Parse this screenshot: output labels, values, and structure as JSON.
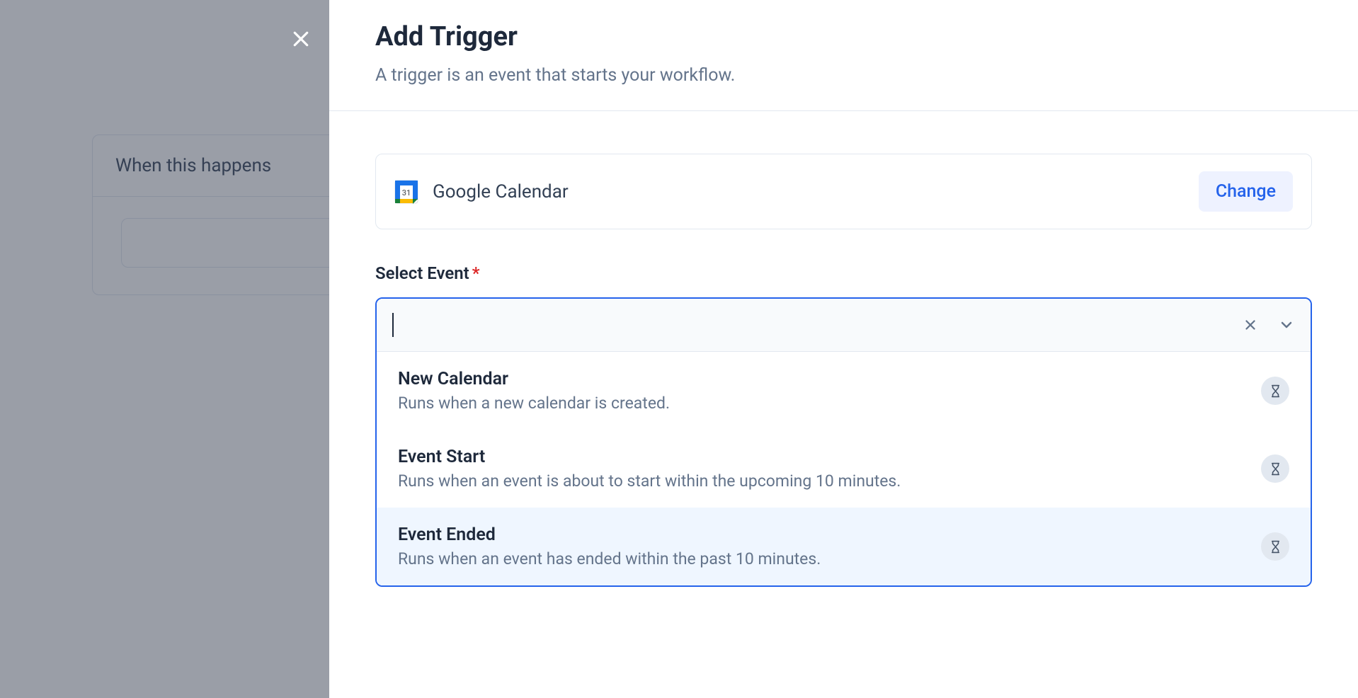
{
  "background": {
    "card_label": "When this happens"
  },
  "panel": {
    "title": "Add Trigger",
    "subtitle": "A trigger is an event that starts your workflow.",
    "app": {
      "name": "Google Calendar",
      "change_label": "Change",
      "icon_date": "31"
    },
    "select": {
      "label": "Select Event",
      "required_mark": "*",
      "value": "",
      "options": [
        {
          "title": "New Calendar",
          "description": "Runs when a new calendar is created.",
          "badge": "hourglass",
          "highlighted": false
        },
        {
          "title": "Event Start",
          "description": "Runs when an event is about to start within the upcoming 10 minutes.",
          "badge": "hourglass",
          "highlighted": false
        },
        {
          "title": "Event Ended",
          "description": "Runs when an event has ended within the past 10 minutes.",
          "badge": "hourglass",
          "highlighted": true
        }
      ]
    }
  }
}
